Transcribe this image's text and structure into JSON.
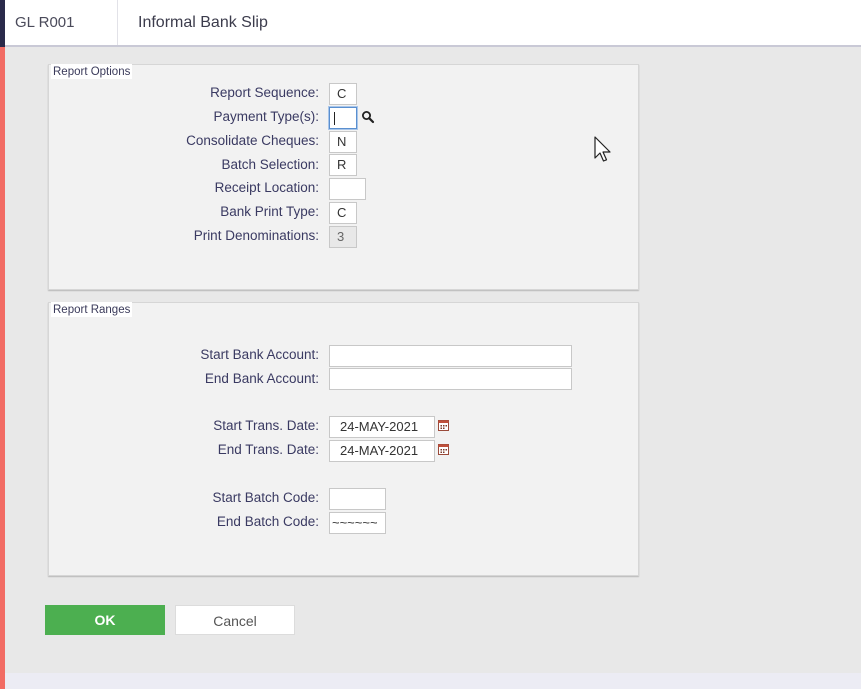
{
  "header": {
    "program_code": "GL R001",
    "program_title": "Informal Bank Slip"
  },
  "report_options": {
    "title": "Report Options",
    "fields": [
      {
        "label": "Report Sequence:",
        "value": "C"
      },
      {
        "label": "Payment Type(s):",
        "value": ""
      },
      {
        "label": "Consolidate Cheques:",
        "value": "N"
      },
      {
        "label": "Batch Selection:",
        "value": "R"
      },
      {
        "label": "Receipt Location:",
        "value": ""
      },
      {
        "label": "Bank Print Type:",
        "value": "C"
      },
      {
        "label": "Print Denominations:",
        "value": "3"
      }
    ]
  },
  "report_ranges": {
    "title": "Report Ranges",
    "fields": [
      {
        "label": "Start Bank Account:",
        "value": ""
      },
      {
        "label": "End Bank Account:",
        "value": ""
      },
      {
        "label": "Start Trans. Date:",
        "value": "24-MAY-2021"
      },
      {
        "label": "End Trans. Date:",
        "value": "24-MAY-2021"
      },
      {
        "label": "Start Batch Code:",
        "value": ""
      },
      {
        "label": "End Batch Code:",
        "value": "~~~~~~"
      }
    ]
  },
  "actions": {
    "ok_label": "OK",
    "cancel_label": "Cancel"
  },
  "icons": {
    "lookup": "magnifier-icon",
    "calendar": "calendar-icon",
    "cursor": "mouse-pointer-icon"
  },
  "colors": {
    "accent_left": "#f26c64",
    "ok_button": "#4caf50",
    "focus_border": "#5a8fcf"
  }
}
